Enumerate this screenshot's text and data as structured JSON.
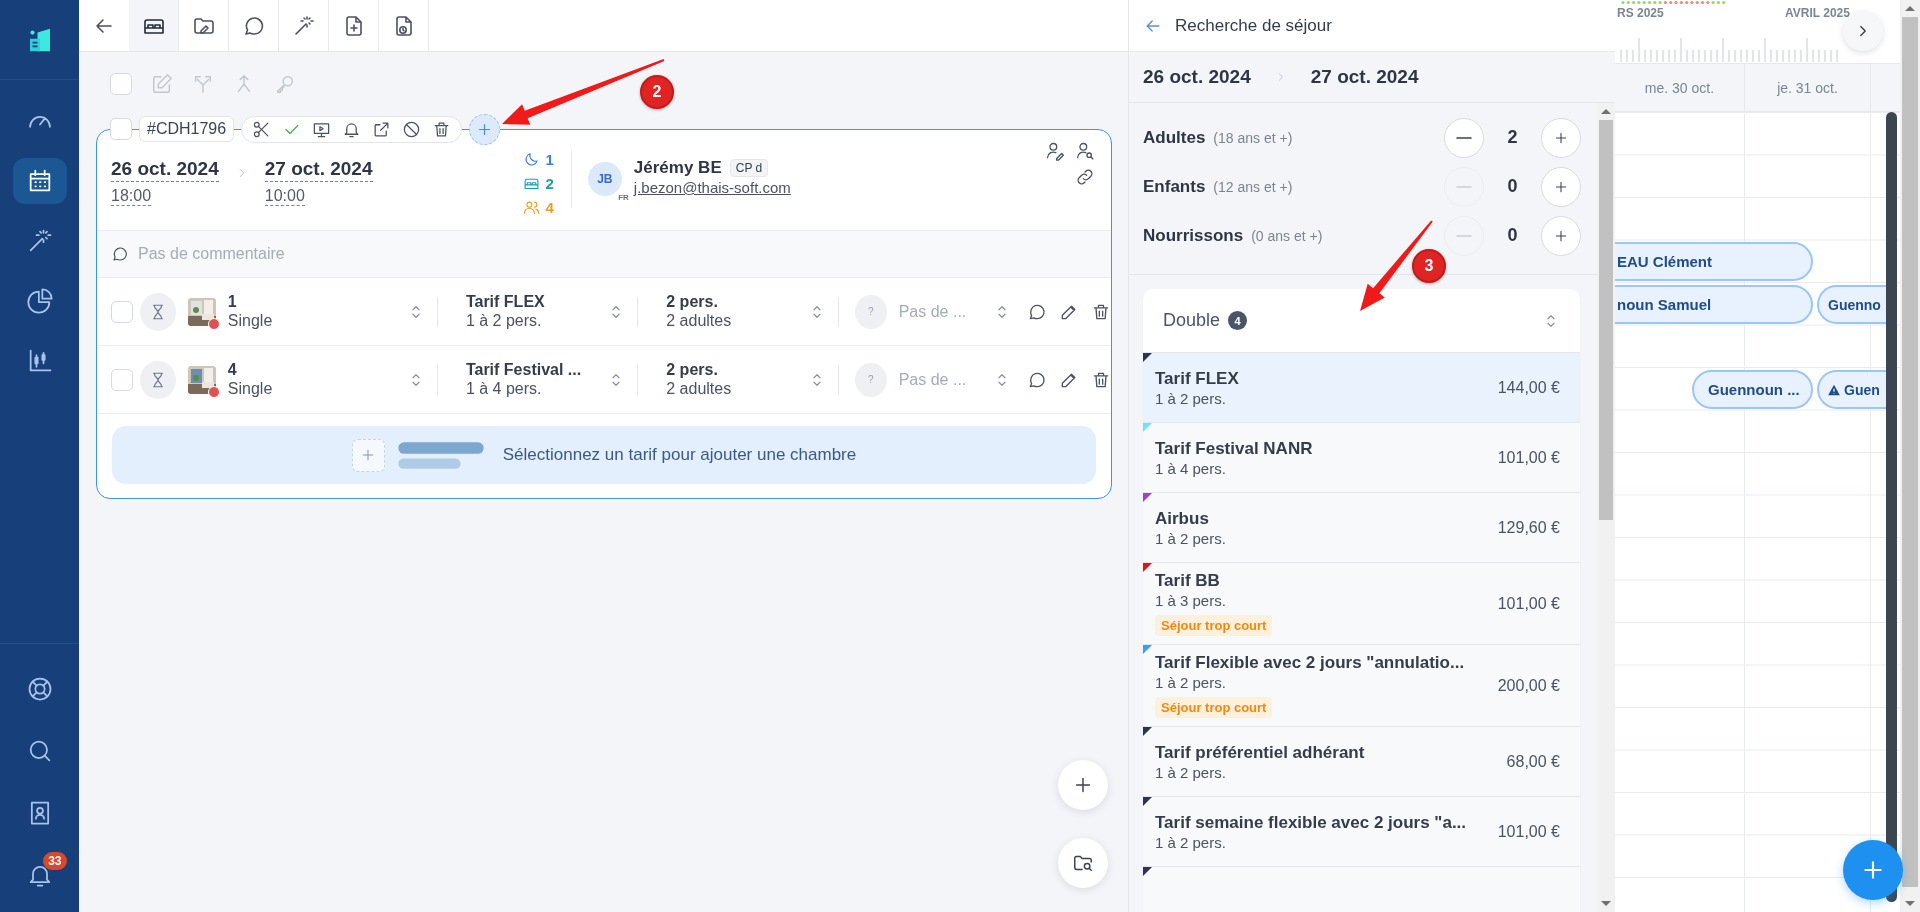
{
  "sidebar": {
    "items": [
      {
        "selected": false
      },
      {
        "selected": true
      },
      {
        "selected": false
      },
      {
        "selected": false
      },
      {
        "selected": false
      }
    ],
    "bottom_items": [
      {
        "selected": false
      },
      {
        "selected": false
      },
      {
        "selected": false
      },
      {
        "selected": false,
        "badge": "33"
      }
    ]
  },
  "top_tabs": [
    {
      "selected": true
    },
    {
      "selected": false
    },
    {
      "selected": false
    },
    {
      "selected": false
    },
    {
      "selected": false
    },
    {
      "selected": false
    }
  ],
  "toolbar": {
    "checked": false,
    "disabled": true
  },
  "booking": {
    "checked": false,
    "code": "#CDH1796",
    "arrival": {
      "date": "26 oct. 2024",
      "time": "18:00"
    },
    "departure": {
      "date": "27 oct. 2024",
      "time": "10:00"
    },
    "nights": "1",
    "rooms": "2",
    "guests": "4",
    "guest": {
      "initials": "JB",
      "lang": "FR",
      "name": "Jérémy BE",
      "tag": "CP d",
      "email": "j.bezon@thais-soft.com"
    },
    "comment_placeholder": "Pas de commentaire",
    "room_lines": [
      {
        "checked": false,
        "number": "1",
        "type": "Single",
        "color": "#e05252",
        "rate": "Tarif FLEX",
        "rate_capacity": "1 à 2 pers.",
        "occupancy": "2 pers.",
        "occupancy_detail": "2 adultes",
        "guest_initial": "?",
        "guest": "Pas de ..."
      },
      {
        "checked": false,
        "number": "4",
        "type": "Single",
        "color": "#e05252",
        "rate": "Tarif Festival ...",
        "rate_capacity": "1 à 4 pers.",
        "occupancy": "2 pers.",
        "occupancy_detail": "2 adultes",
        "guest_initial": "?",
        "guest": "Pas de ..."
      }
    ],
    "add_room_text": "Sélectionnez un tarif pour ajouter une chambre"
  },
  "search_panel": {
    "title": "Recherche de séjour",
    "from": "26 oct. 2024",
    "to": "27 oct. 2024",
    "counters": [
      {
        "label": "Adultes",
        "hint": "(18 ans et +)",
        "value": "2",
        "minus_disabled": false
      },
      {
        "label": "Enfants",
        "hint": "(12 ans et +)",
        "value": "0",
        "minus_disabled": true
      },
      {
        "label": "Nourrissons",
        "hint": "(0 ans et +)",
        "value": "0",
        "minus_disabled": true
      }
    ],
    "room_group": {
      "name": "Double",
      "count": "4",
      "rates": [
        {
          "name": "Tarif FLEX",
          "capacity": "1 à 2 pers.",
          "price": "144,00 €",
          "color": "#2b3552",
          "selected": true
        },
        {
          "name": "Tarif Festival NANR",
          "capacity": "1 à 4 pers.",
          "price": "101,00 €",
          "color": "#6ee6ee",
          "selected": false
        },
        {
          "name": "Airbus",
          "capacity": "1 à 2 pers.",
          "price": "129,60 €",
          "color": "#a23fd9",
          "selected": false
        },
        {
          "name": "Tarif BB",
          "capacity": "1 à 3 pers.",
          "price": "101,00 €",
          "color": "#e8101c",
          "selected": false,
          "warning": "Séjour trop court"
        },
        {
          "name": "Tarif Flexible avec 2 jours \"annulatio...",
          "capacity": "1 à 2 pers.",
          "price": "200,00 €",
          "color": "#3b9cf0",
          "selected": false,
          "warning": "Séjour trop court"
        },
        {
          "name": "Tarif préférentiel adhérant",
          "capacity": "1 à 2 pers.",
          "price": "68,00 €",
          "color": "#2b3552",
          "selected": false
        },
        {
          "name": "Tarif semaine flexible avec 2 jours \"a...",
          "capacity": "1 à 2 pers.",
          "price": "101,00 €",
          "color": "#2b3552",
          "selected": false
        },
        {
          "color": "#2b3552",
          "selected": false
        }
      ]
    }
  },
  "calendar": {
    "months": [
      "RS 2025",
      "AVRIL 2025"
    ],
    "days": [
      "me. 30 oct.",
      "je. 31 oct."
    ],
    "bookings": [
      {
        "label": "EAU Clément",
        "warning": false
      },
      {
        "label": "noun Samuel",
        "warning": false
      },
      {
        "label": "Guenno",
        "warning": false
      },
      {
        "label": "Guennoun ...",
        "warning": false
      },
      {
        "label": "Guen",
        "warning": true
      }
    ]
  },
  "annotations": [
    {
      "label": "2"
    },
    {
      "label": "3"
    }
  ]
}
